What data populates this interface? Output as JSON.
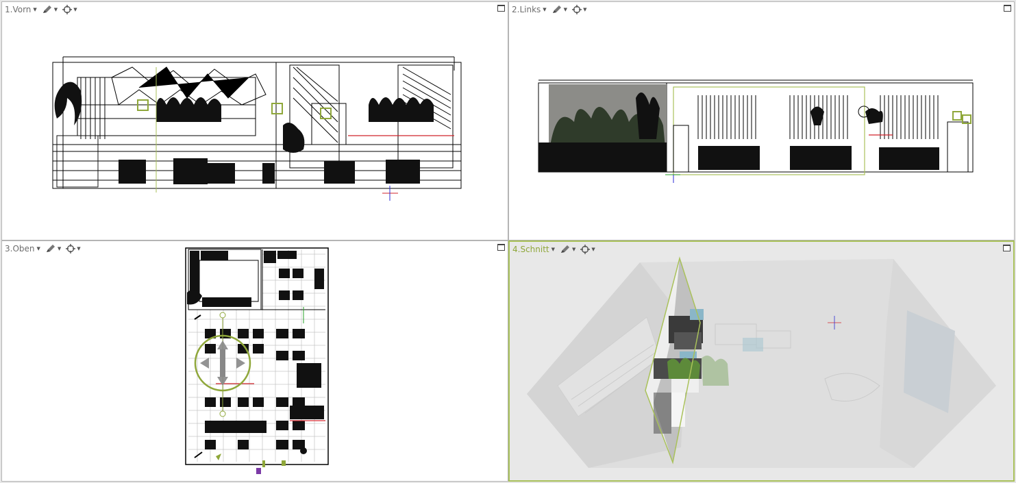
{
  "viewports": [
    {
      "title": "1.Vorn",
      "active": false
    },
    {
      "title": "2.Links",
      "active": false
    },
    {
      "title": "3.Oben",
      "active": false
    },
    {
      "title": "4.Schnitt",
      "active": true
    }
  ],
  "icons": {
    "dropdown": "caret-down-icon",
    "pen": "pen-tool-icon",
    "crosshair": "crosshair-icon",
    "maximize": "maximize-icon"
  },
  "colors": {
    "accent": "#a9c15a",
    "accent_text": "#8fa73a",
    "selection_red": "#d0232b",
    "axis_blue": "#2a2ad6",
    "axis_green": "#28a028",
    "light_purple": "#7b3aa6"
  }
}
